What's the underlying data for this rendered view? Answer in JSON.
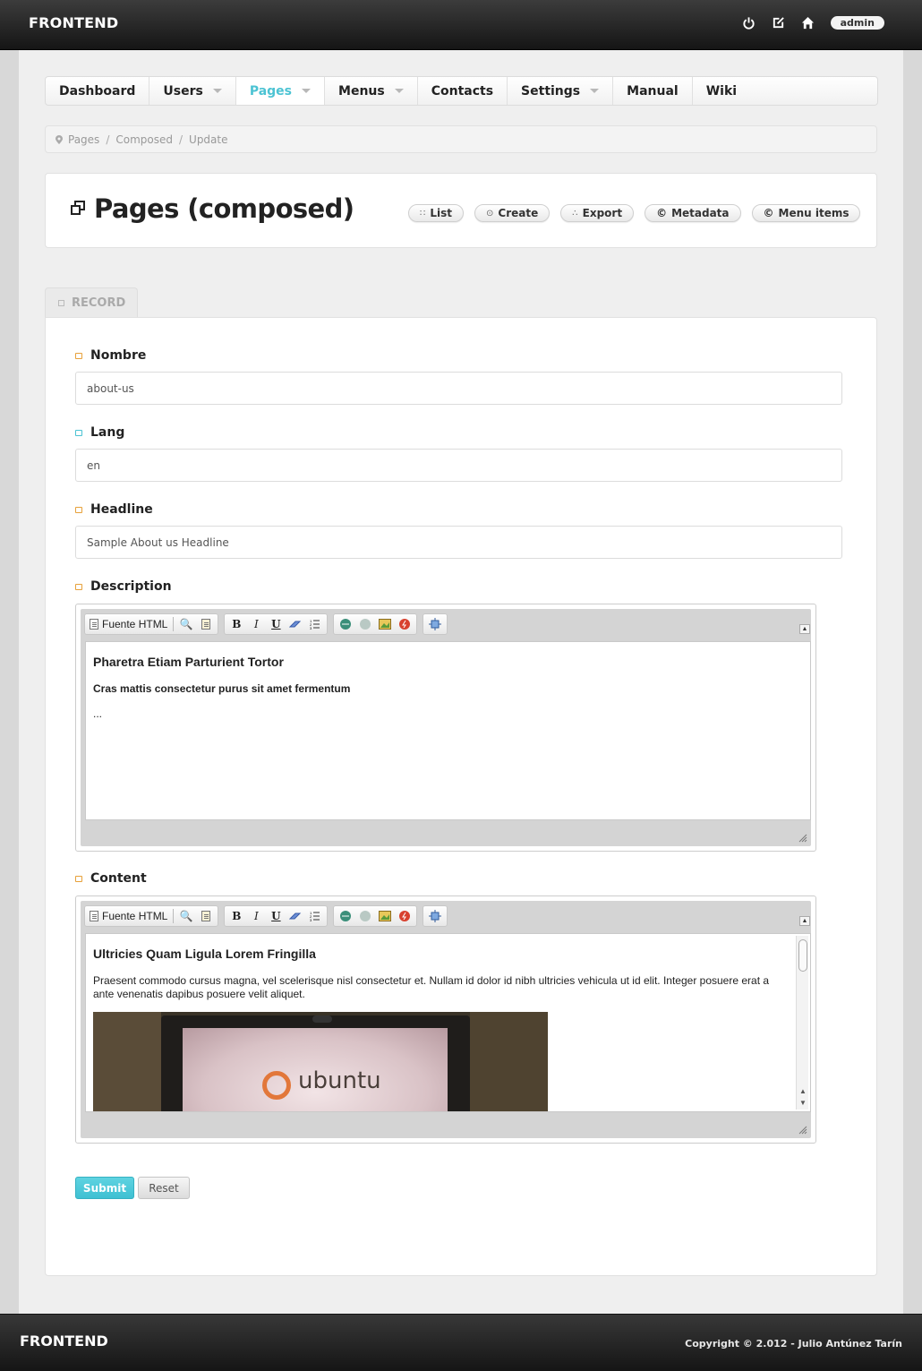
{
  "app": {
    "brand": "FRONTEND",
    "user": "admin"
  },
  "topbar_icons": [
    "power-icon",
    "edit-icon",
    "home-icon"
  ],
  "nav": [
    {
      "label": "Dashboard",
      "dropdown": false,
      "active": false
    },
    {
      "label": "Users",
      "dropdown": true,
      "active": false
    },
    {
      "label": "Pages",
      "dropdown": true,
      "active": true
    },
    {
      "label": "Menus",
      "dropdown": true,
      "active": false
    },
    {
      "label": "Contacts",
      "dropdown": false,
      "active": false
    },
    {
      "label": "Settings",
      "dropdown": true,
      "active": false
    },
    {
      "label": "Manual",
      "dropdown": false,
      "active": false
    },
    {
      "label": "Wiki",
      "dropdown": false,
      "active": false
    }
  ],
  "breadcrumb": [
    "Pages",
    "Composed",
    "Update"
  ],
  "header": {
    "title": "Pages (composed)",
    "actions": [
      {
        "icon": "∷",
        "label": "List"
      },
      {
        "icon": "⊙",
        "label": "Create"
      },
      {
        "icon": "∴",
        "label": "Export"
      },
      {
        "icon": "©",
        "label": "Metadata"
      },
      {
        "icon": "©",
        "label": "Menu items"
      }
    ]
  },
  "tab": {
    "label": "RECORD"
  },
  "fields": {
    "nombre": {
      "label": "Nombre",
      "value": "about-us"
    },
    "lang": {
      "label": "Lang",
      "value": "en"
    },
    "headline": {
      "label": "Headline",
      "value": "Sample About us Headline"
    },
    "description": {
      "label": "Description",
      "heading": "Pharetra Etiam Parturient Tortor",
      "subheading": "Cras mattis consectetur purus sit amet fermentum",
      "body": "..."
    },
    "content": {
      "label": "Content",
      "heading": "Ultricies Quam Ligula Lorem Fringilla",
      "body": "Praesent commodo cursus magna, vel scelerisque nisl consectetur et. Nullam id dolor id nibh ultricies vehicula ut id elit. Integer posuere erat a ante venenatis dapibus posuere velit aliquet.",
      "image_text": "ubuntu"
    }
  },
  "editor_toolbar": {
    "source_label": "Fuente HTML"
  },
  "buttons": {
    "submit": "Submit",
    "reset": "Reset"
  },
  "footer": {
    "brand": "FRONTEND",
    "copyright": "Copyright © 2.012 - Julio Antúnez Tarín"
  },
  "colors": {
    "accent": "#4cc3d3",
    "label_tag": "#e7a13b"
  }
}
